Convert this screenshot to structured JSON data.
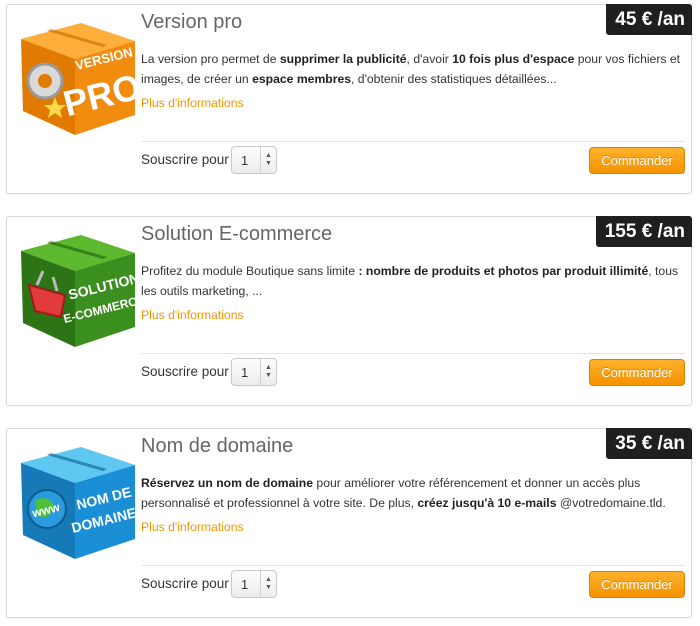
{
  "products": [
    {
      "title": "Version pro",
      "price": "45 € /an",
      "box_lines": [
        "VERSION",
        "PRO"
      ],
      "box_color": "#f28c0f",
      "desc": [
        {
          "t": "La version pro permet de ",
          "b": false
        },
        {
          "t": "supprimer la publicité",
          "b": true
        },
        {
          "t": ", d'avoir ",
          "b": false
        },
        {
          "t": "10 fois plus d'espace",
          "b": true
        },
        {
          "t": " pour vos fichiers et images, de créer un ",
          "b": false
        },
        {
          "t": "espace membres",
          "b": true
        },
        {
          "t": ", d'obtenir des statistiques détaillées...",
          "b": false
        }
      ],
      "more_label": "Plus d'informations",
      "subscribe_label": "Souscrire pour",
      "qty": "1",
      "button_label": "Commander"
    },
    {
      "title": "Solution E-commerce",
      "price": "155 € /an",
      "box_lines": [
        "SOLUTION",
        "E-COMMERCE"
      ],
      "box_color": "#3a8f1f",
      "desc": [
        {
          "t": "Profitez du module Boutique sans limite ",
          "b": false
        },
        {
          "t": ": nombre de produits et photos par produit illimité",
          "b": true
        },
        {
          "t": ", tous les outils marketing, ...",
          "b": false
        }
      ],
      "more_label": "Plus d'informations",
      "subscribe_label": "Souscrire pour",
      "qty": "1",
      "button_label": "Commander"
    },
    {
      "title": "Nom de domaine",
      "price": "35 € /an",
      "box_lines": [
        "NOM DE",
        "DOMAINE"
      ],
      "box_color": "#1a8fd6",
      "desc": [
        {
          "t": "Réservez un nom de domaine",
          "b": true
        },
        {
          "t": " pour améliorer votre référencement et donner un accès plus personnalisé et professionnel à votre site. De plus, ",
          "b": false
        },
        {
          "t": "créez jusqu'à 10 e-mails",
          "b": true
        },
        {
          "t": " @votredomaine.tld.",
          "b": false
        }
      ],
      "more_label": "Plus d'informations",
      "subscribe_label": "Souscrire pour",
      "qty": "1",
      "button_label": "Commander"
    }
  ]
}
